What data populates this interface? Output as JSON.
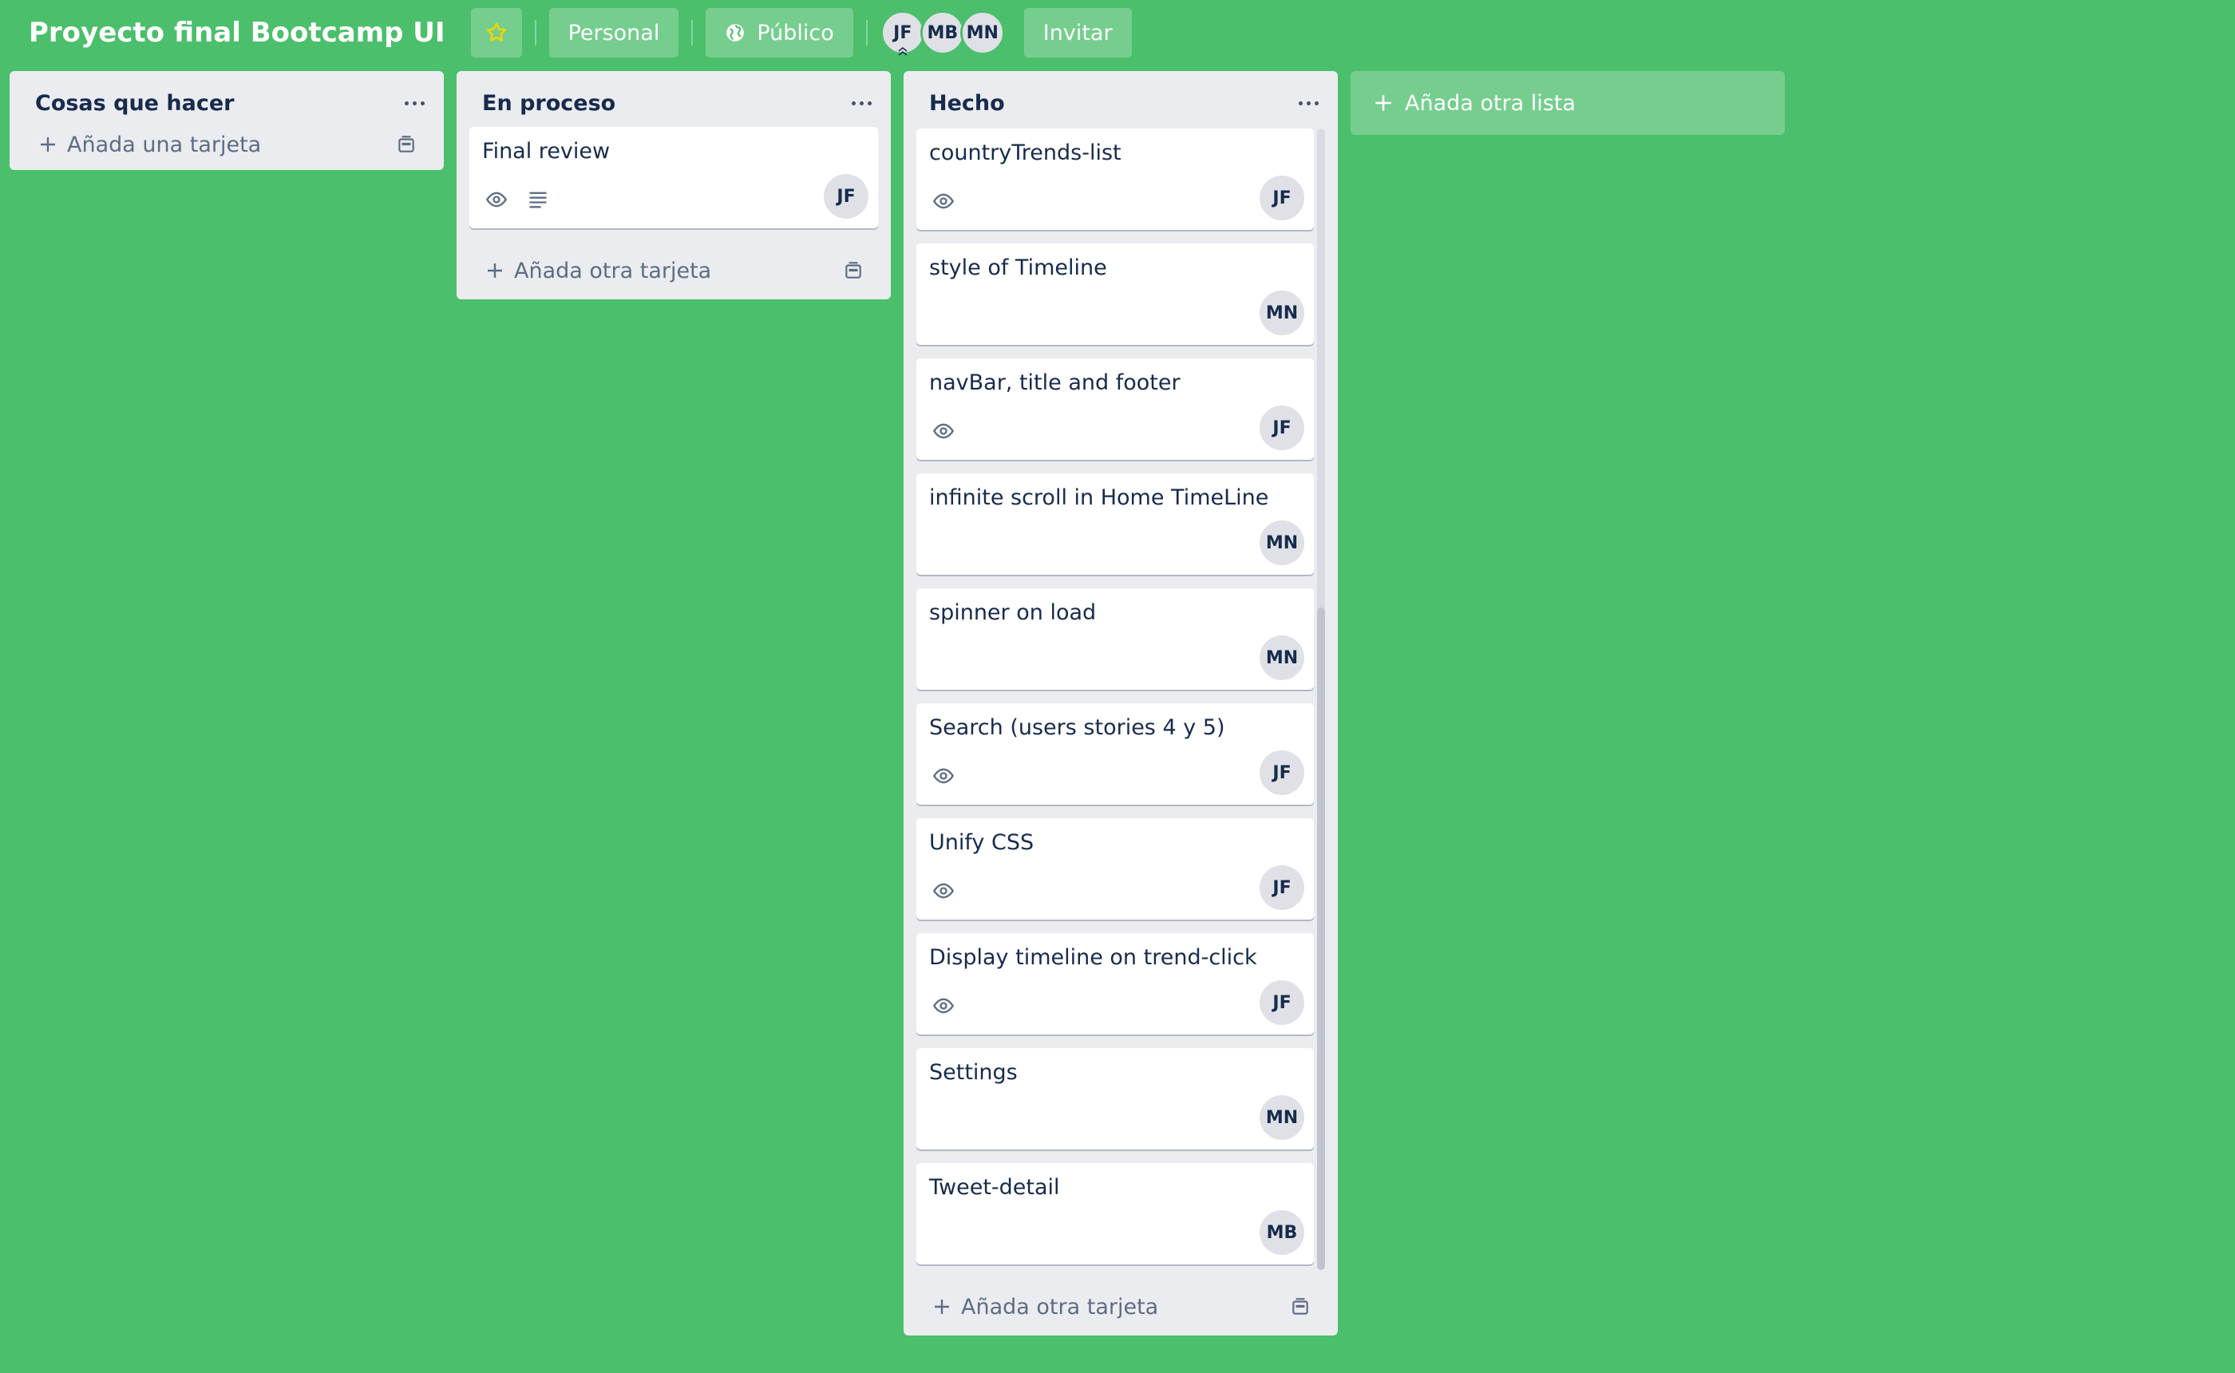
{
  "board": {
    "title": "Proyecto final Bootcamp UI",
    "visibility_team": "Personal",
    "visibility": "Público",
    "invite_label": "Invitar",
    "members": [
      "JF",
      "MB",
      "MN"
    ],
    "background_color": "#4bbf6b"
  },
  "lists": [
    {
      "title": "Cosas que hacer",
      "cards": [],
      "add_label": "Añada una tarjeta"
    },
    {
      "title": "En proceso",
      "cards": [
        {
          "title": "Final review",
          "badges": [
            "eye-icon",
            "description-icon"
          ],
          "member": "JF"
        }
      ],
      "add_label": "Añada otra tarjeta"
    },
    {
      "title": "Hecho",
      "cards": [
        {
          "title": "countryTrends-list",
          "badges": [
            "eye-icon"
          ],
          "member": "JF"
        },
        {
          "title": "style of Timeline",
          "badges": [],
          "member": "MN"
        },
        {
          "title": "navBar, title and footer",
          "badges": [
            "eye-icon"
          ],
          "member": "JF"
        },
        {
          "title": "infinite scroll in Home TimeLine",
          "badges": [],
          "member": "MN"
        },
        {
          "title": "spinner on load",
          "badges": [],
          "member": "MN"
        },
        {
          "title": "Search (users stories 4 y 5)",
          "badges": [
            "eye-icon"
          ],
          "member": "JF"
        },
        {
          "title": "Unify CSS",
          "badges": [
            "eye-icon"
          ],
          "member": "JF"
        },
        {
          "title": "Display timeline on trend-click",
          "badges": [
            "eye-icon"
          ],
          "member": "JF"
        },
        {
          "title": "Settings",
          "badges": [],
          "member": "MN"
        },
        {
          "title": "Tweet-detail",
          "badges": [],
          "member": "MB"
        }
      ],
      "add_label": "Añada otra tarjeta"
    }
  ],
  "add_list_label": "Añada otra lista"
}
